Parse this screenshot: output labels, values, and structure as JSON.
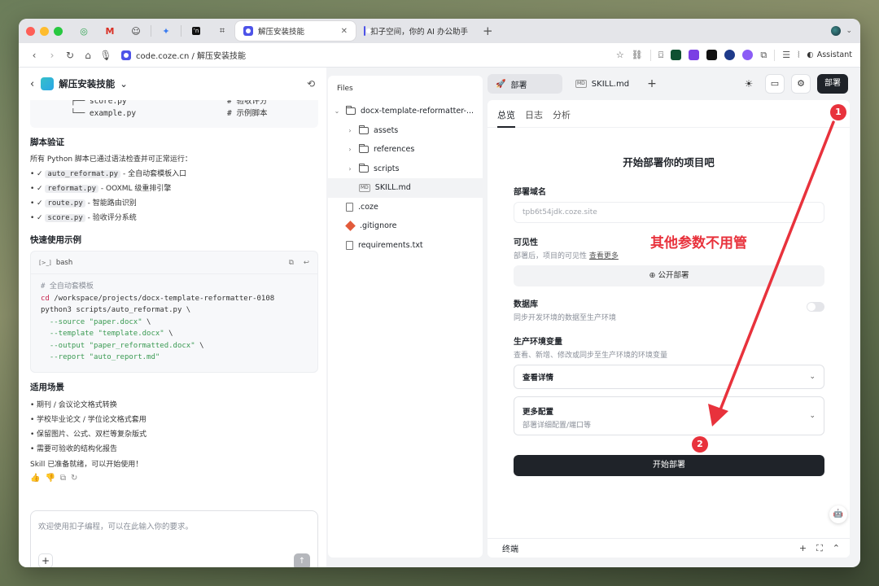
{
  "browser": {
    "tabs": [
      {
        "label": "解压安装技能"
      },
      {
        "label": "扣子空间，你的 AI 办公助手"
      }
    ],
    "url": "code.coze.cn / 解压安装技能",
    "assistant_label": "Assistant"
  },
  "chat": {
    "title": "解压安装技能",
    "tree": [
      {
        "path": "├── score.py",
        "comment": "# 验收评分"
      },
      {
        "path": "└── example.py",
        "comment": "# 示例脚本"
      }
    ],
    "verify_heading": "脚本验证",
    "verify_intro": "所有 Python 脚本已通过语法检查并可正常运行：",
    "verify_items": [
      {
        "code": "auto_reformat.py",
        "desc": " - 全自动套模板入口"
      },
      {
        "code": "reformat.py",
        "desc": " - OOXML 级重排引擎"
      },
      {
        "code": "route.py",
        "desc": " - 智能路由识别"
      },
      {
        "code": "score.py",
        "desc": " - 验收评分系统"
      }
    ],
    "check_mark": "✓ ",
    "quick_heading": "快速使用示例",
    "code_lang": "bash",
    "code_lang_icon": "[>_]",
    "code_comment": "# 全自动套模板",
    "code_cd": "cd",
    "code_cd_path": " /workspace/projects/docx-template-reformatter-0108",
    "code_py": "python3 scripts/auto_reformat.py \\",
    "code_args": [
      {
        "flag": "  --source",
        "val": " \"paper.docx\"",
        "end": " \\"
      },
      {
        "flag": "  --template",
        "val": " \"template.docx\"",
        "end": " \\"
      },
      {
        "flag": "  --output",
        "val": " \"paper_reformatted.docx\"",
        "end": " \\"
      },
      {
        "flag": "  --report",
        "val": " \"auto_report.md\"",
        "end": ""
      }
    ],
    "scene_heading": "适用场景",
    "scene_items": [
      "期刊 / 会议论文格式转换",
      "学校毕业论文 / 学位论文格式套用",
      "保留图片、公式、双栏等复杂版式",
      "需要可验收的结构化报告"
    ],
    "final_text": "Skill 已准备就绪，可以开始使用！",
    "input_placeholder": "欢迎使用扣子编程，可以在此输入你的要求。"
  },
  "files": {
    "header": "Files",
    "items": [
      {
        "name": "docx-template-reformatter-...",
        "kind": "folder",
        "open": true,
        "indent": 0
      },
      {
        "name": "assets",
        "kind": "folder",
        "indent": 1
      },
      {
        "name": "references",
        "kind": "folder",
        "indent": 1
      },
      {
        "name": "scripts",
        "kind": "folder",
        "indent": 1
      },
      {
        "name": "SKILL.md",
        "kind": "md",
        "indent": 1,
        "selected": true
      },
      {
        "name": ".coze",
        "kind": "file",
        "indent": 0
      },
      {
        "name": ".gitignore",
        "kind": "git",
        "indent": 0
      },
      {
        "name": "requirements.txt",
        "kind": "file",
        "indent": 0
      }
    ]
  },
  "editor_tabs": {
    "deploy": "部署",
    "skill": "SKILL.md",
    "deploy_button": "部署"
  },
  "deploy": {
    "tabs": [
      "总览",
      "日志",
      "分析"
    ],
    "title": "开始部署你的项目吧",
    "domain_label": "部署域名",
    "domain_value": "tpb6t54jdk.coze.site",
    "visibility_label": "可见性",
    "visibility_desc": "部署后，项目的可见性",
    "visibility_more": "查看更多",
    "public_btn": "公开部署",
    "db_label": "数据库",
    "db_desc": "同步开发环境的数据至生产环境",
    "env_label": "生产环境变量",
    "env_desc": "查看、新增、修改或同步至生产环境的环境变量",
    "env_select": "查看详情",
    "more_label": "更多配置",
    "more_desc": "部署详细配置/端口等",
    "start_btn": "开始部署",
    "terminal": "终端"
  },
  "annotation": {
    "text": "其他参数不用管",
    "badge1": "1",
    "badge2": "2",
    "color": "#e8323c"
  }
}
